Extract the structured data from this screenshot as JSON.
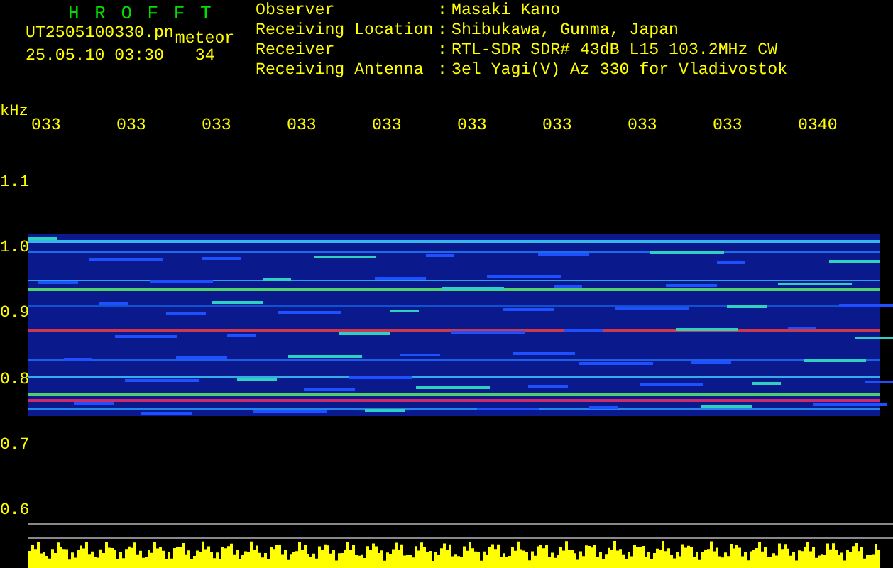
{
  "header": {
    "title": "H R O F F T",
    "filename": "UT2505100330.pn",
    "mode": "meteor",
    "datetime": "25.05.10 03:30",
    "count": "34",
    "info": [
      {
        "label": "Observer",
        "separator": ":",
        "value": "Masaki Kano"
      },
      {
        "label": "Receiving Location",
        "separator": ":",
        "value": "Shibukawa, Gunma, Japan"
      },
      {
        "label": "Receiver",
        "separator": ":",
        "value": "RTL-SDR SDR# 43dB L15 103.2MHz CW"
      },
      {
        "label": "Receiving Antenna",
        "separator": ":",
        "value": "3el Yagi(V) Az 330 for Vladivostok"
      }
    ]
  },
  "axis": {
    "unit": "kHz",
    "time_labels": [
      "033",
      "033",
      "033",
      "033",
      "033",
      "033",
      "033",
      "033",
      "033",
      "0340"
    ],
    "freq_labels": [
      "1.1",
      "1.0",
      "0.9",
      "0.8",
      "0.7",
      "0.6"
    ]
  }
}
